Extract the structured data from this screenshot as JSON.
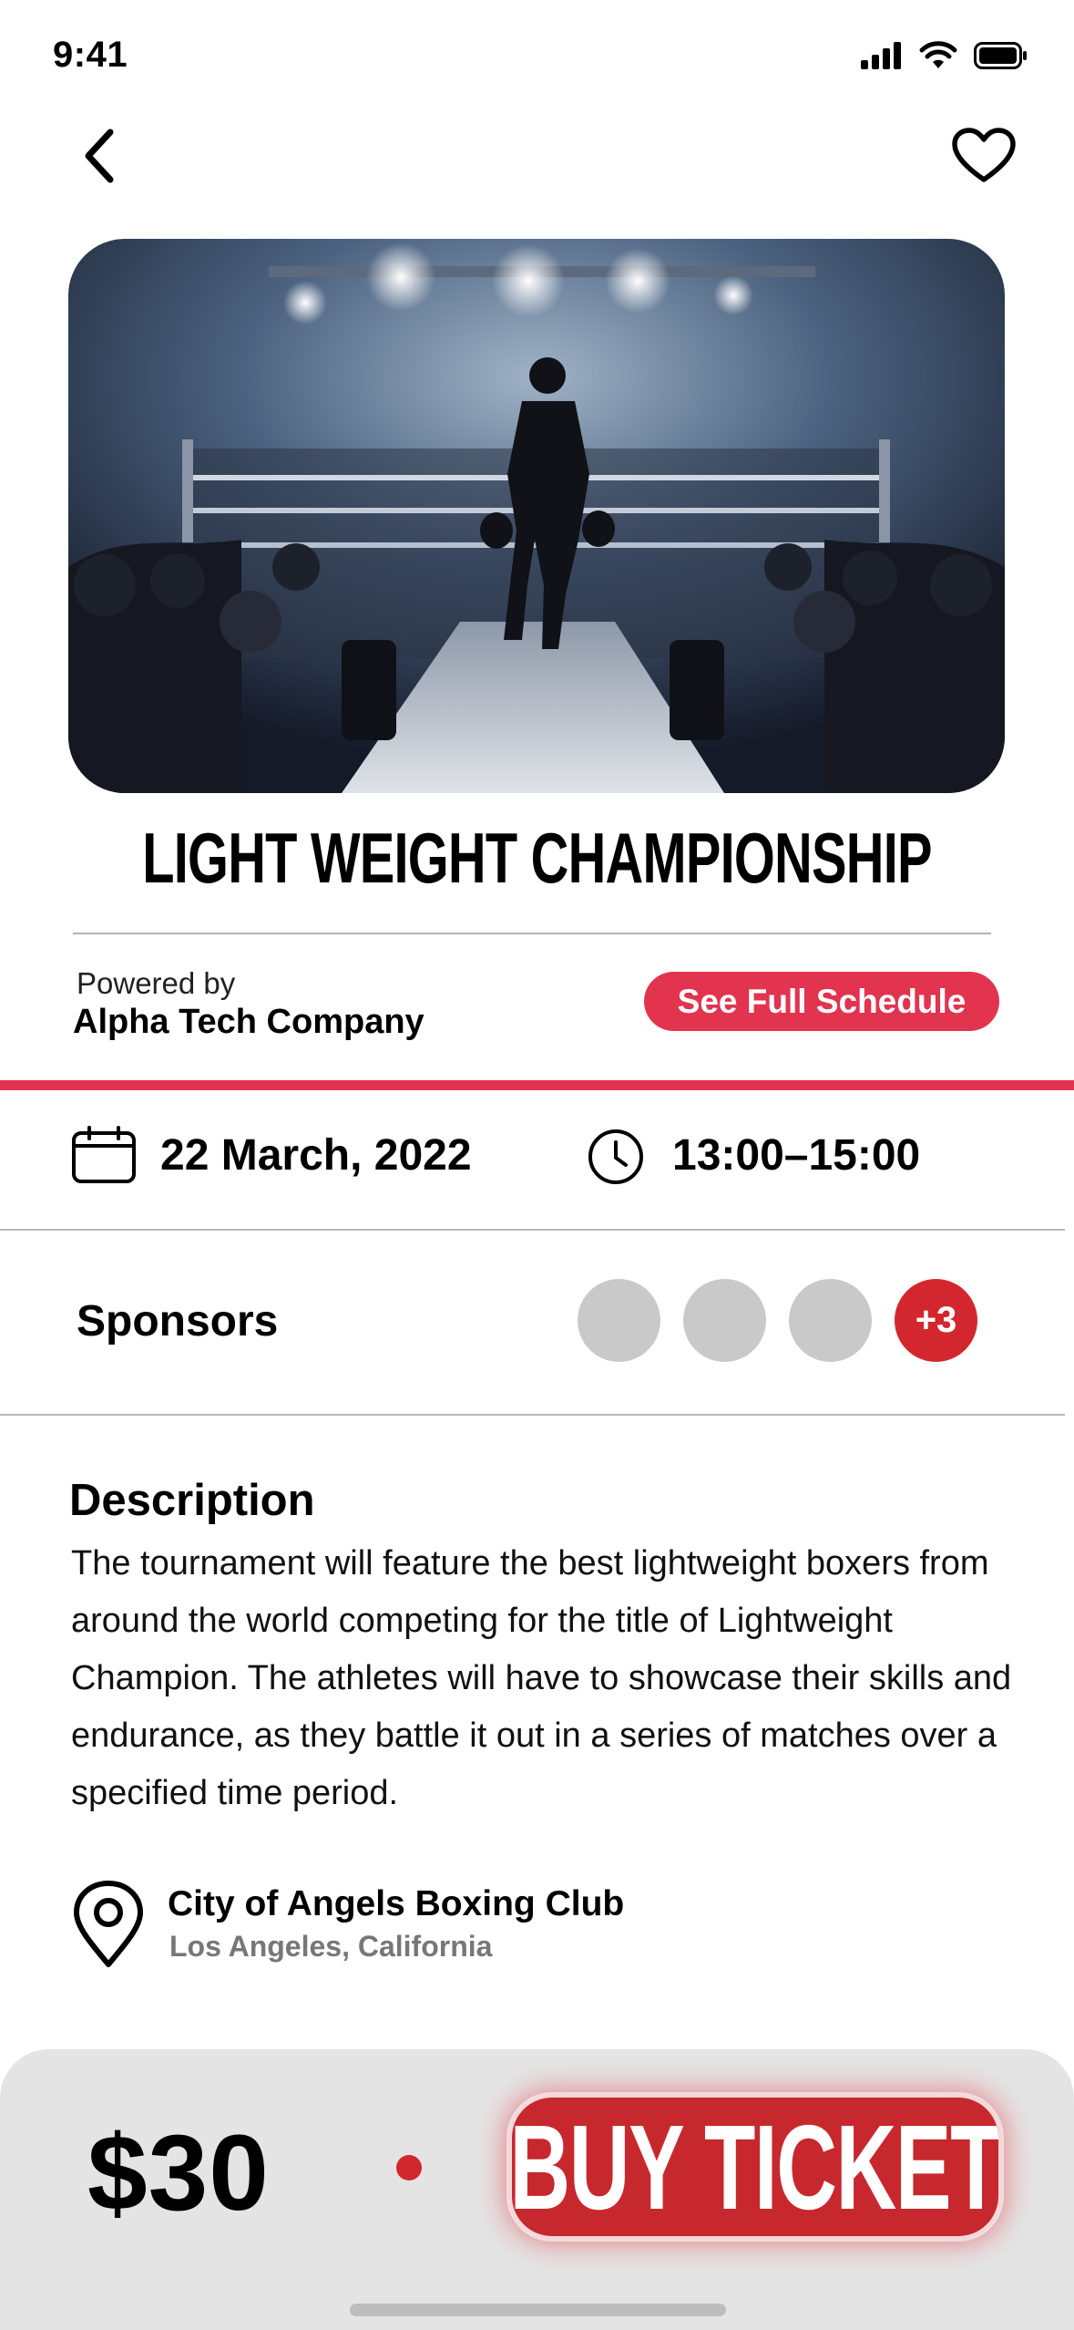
{
  "status_bar": {
    "time": "9:41"
  },
  "nav": {
    "back_icon": "chevron-left-icon",
    "favorite_icon": "heart-outline-icon"
  },
  "event": {
    "title": "LIGHT WEIGHT CHAMPIONSHIP",
    "powered_by_label": "Powered by",
    "company": "Alpha Tech Company",
    "schedule_button": "See Full Schedule",
    "date": "22 March, 2022",
    "time": "13:00–15:00"
  },
  "sponsors": {
    "label": "Sponsors",
    "more_count": "+3"
  },
  "description": {
    "heading": "Description",
    "body": "The tournament will feature the best lightweight boxers from around the world competing for the title of Lightweight Champion. The athletes will have to showcase their skills and endurance, as they battle it out in a series of matches over a specified time period."
  },
  "venue": {
    "name": "City of Angels Boxing Club",
    "location": "Los Angeles, California"
  },
  "purchase": {
    "price": "$30",
    "buy_button": "BUY TICKET"
  },
  "colors": {
    "accent_pink": "#e2334f",
    "accent_red": "#c7282e",
    "bottom_bar": "#e4e4e4"
  }
}
